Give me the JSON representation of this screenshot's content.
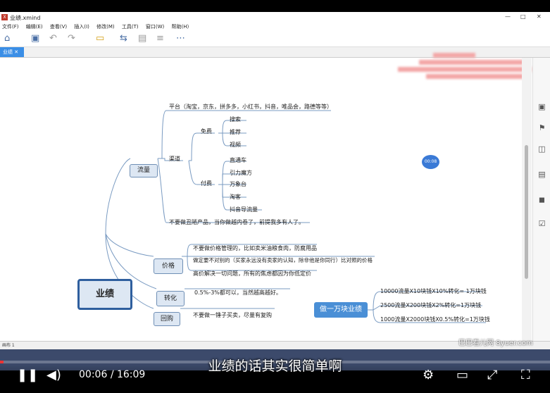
{
  "app": {
    "title": "业绩.xmind",
    "logo": "X"
  },
  "menu": [
    "文件(F)",
    "编辑(E)",
    "查看(V)",
    "插入(I)",
    "修改(M)",
    "工具(T)",
    "窗口(W)",
    "帮助(H)"
  ],
  "tab": {
    "label": "业绩"
  },
  "mindmap": {
    "central": "业绩",
    "liuliang": {
      "label": "流量",
      "platform": "平台（淘宝，京东，拼多多，小红书，抖音，唯品会，路德等等）",
      "channel": "渠道",
      "free": "免费",
      "free_items": [
        "搜索",
        "推荐",
        "视频"
      ],
      "paid": "付费",
      "paid_items": [
        "直通车",
        "引力魔方",
        "万象台",
        "淘客",
        "抖音导流量"
      ],
      "note": "不要做丑陋产品，当你做越内卷了，前提我多有人了。"
    },
    "jiage": {
      "label": "价格",
      "items": [
        "不要做价格管理的，比如卖米油粮食肉，防腐用品",
        "做定要不对别的（买家永远没有卖家的认知，除非他是你同行）比对照的价格",
        "高价解决一切问题，所有的焦虑都因为你低定价"
      ]
    },
    "zhuanhua": {
      "label": "转化",
      "items": [
        "0.5%-3%都可以，当然越高越好。"
      ]
    },
    "huigou": {
      "label": "回购",
      "items": [
        "不要做一锤子买卖，尽量有复购"
      ]
    },
    "goal": {
      "label": "做一万块业绩",
      "items": [
        "10000流量X10块钱X10%转化= 1万块钱",
        "2500流量X200块钱X2%转化=1万块钱",
        "1000流量X2000块钱X0.5%转化=1万块钱"
      ]
    }
  },
  "timer": "00:08",
  "statusbar": "画布 1",
  "video": {
    "current": "00:06",
    "sep": "/",
    "total": "16:09",
    "subtitle": "业绩的话其实很简单啊",
    "watermark": "巴巴看儿网 8yuer.com",
    "progress": 0.006
  }
}
